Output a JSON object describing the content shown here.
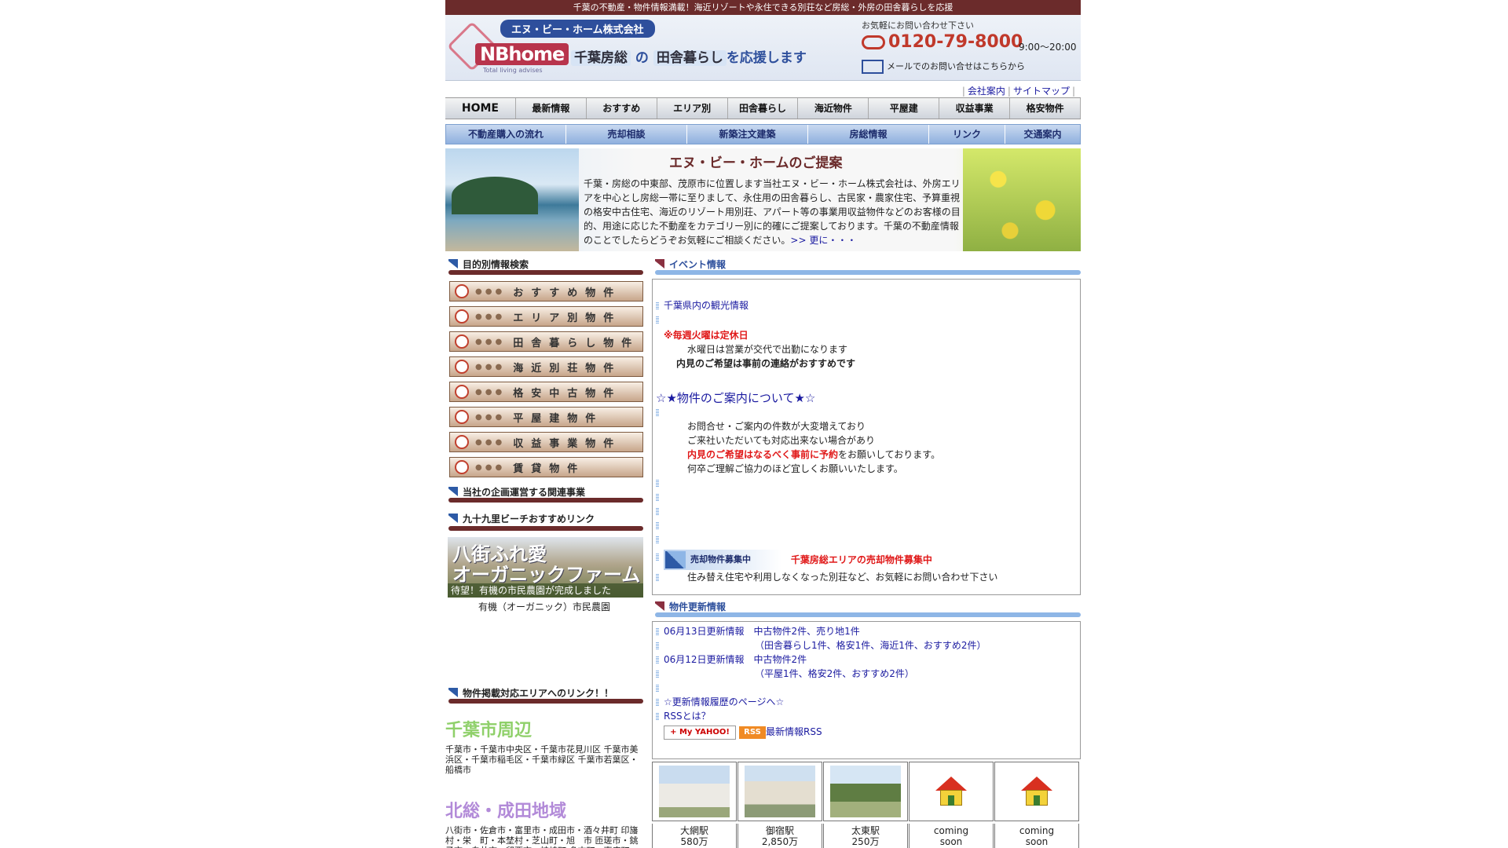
{
  "topbar": "千葉の不動産・物件情報満載！海近リゾートや永住できる別荘など房総・外房の田舎暮らしを応援",
  "header": {
    "company": "エヌ・ビー・ホーム株式会社",
    "logo": "NBhome",
    "logo_sub": "Total living advises",
    "tagline_a": "千葉房総",
    "tagline_b": "の",
    "tagline_c": "田舎暮らし",
    "tagline_d": "を応援します",
    "contact_note": "お気軽にお問い合わせ下さい",
    "phone": "0120-79-8000",
    "hours": "9:00〜20:00",
    "mail": "メールでのお問い合せはこちらから"
  },
  "subnav": {
    "company": "会社案内",
    "sitemap": "サイトマップ"
  },
  "mainnav": [
    "HOME",
    "最新情報",
    "おすすめ",
    "エリア別",
    "田舎暮らし",
    "海近物件",
    "平屋建",
    "収益事業",
    "格安物件"
  ],
  "subnav2": [
    "不動産購入の流れ",
    "売却相談",
    "新築注文建築",
    "房総情報",
    "リンク",
    "交通案内"
  ],
  "banner": {
    "title": "エヌ・ビー・ホームのご提案",
    "text": "千葉・房総の中東部、茂原市に位置します当社エヌ・ビー・ホーム株式会社は、外房エリアを中心とし房総一帯に至りまして、永住用の田舎暮らし、古民家・農家住宅、予算重視の格安中古住宅、海近のリゾート用別荘、アパート等の事業用収益物件などのお客様の目的、用途に応じた不動産をカテゴリー別に的確にご提案しております。千葉の不動産情報のことでしたらどうぞお気軽にご相談ください。",
    "more": ">> 更に・・・"
  },
  "left": {
    "search_head": "目的別情報検索",
    "categories": [
      "おすすめ物件",
      "エリア別物件",
      "田舎暮らし物件",
      "海近別荘物件",
      "格安中古物件",
      "平屋建物件",
      "収益事業物件",
      "賃貸物件"
    ],
    "related_head": "当社の企画運営する関連事業",
    "beach_head": "九十九里ビーチおすすめリンク",
    "farm_t1": "八街ふれ愛",
    "farm_t2": "オーガニックファーム",
    "farm_t3": "待望！有機の市民農園が完成しました",
    "farm_caption": "有機（オーガニック）市民農園",
    "area_head": "物件掲載対応エリアへのリンク！！",
    "area1_title": "千葉市周辺",
    "area1_list": "千葉市・千葉市中央区・千葉市花見川区 千葉市美浜区・千葉市稲毛区・千葉市緑区 千葉市若葉区・船橋市",
    "area2_title": "北総・成田地域",
    "area2_list": "八街市・佐倉市・富里市・成田市・酒々井町 印旛村・栄　町・本埜村・芝山町・旭　市 匝瑳市・銚子市・白井市・印西市・神崎町 多古町・東庄町"
  },
  "event": {
    "head": "イベント情報",
    "l1": "千葉県内の観光情報",
    "l2": "※毎週火曜は定休日",
    "l3": "水曜日は営業が交代で出勤になります",
    "l4": "内見のご希望は事前の連絡がおすすめです",
    "l5": "☆★物件のご案内について★☆",
    "l6": "お問合せ・ご案内の件数が大変増えており",
    "l7": "ご来社いただいても対応出来ない場合があり",
    "l8a": "内見のご希望はなるべく事前に予約",
    "l8b": "をお願いしております。",
    "l9": "何卒ご理解ご協力のほど宜しくお願いいたします。",
    "sale_badge": "売却物件募集中",
    "sale_title": "千葉房総エリアの売却物件募集中",
    "sale_text": "住み替え住宅や利用しなくなった別荘など、お気軽にお問い合わせ下さい"
  },
  "updates": {
    "head": "物件更新情報",
    "u1": "06月13日更新情報　中古物件2件、売り地1件",
    "u1b": "（田舎暮らし1件、格安1件、海近1件、おすすめ2件）",
    "u2": "06月12日更新情報　中古物件2件",
    "u2b": "（平屋1件、格安2件、おすすめ2件）",
    "history": "☆更新情報履歴のページへ☆",
    "rss_what": "RSSとは？",
    "myyahoo": "+ My YAHOO!",
    "rss": "RSS",
    "latest_rss": "最新情報RSS"
  },
  "properties": [
    {
      "station": "大網駅",
      "price": "580万"
    },
    {
      "station": "御宿駅",
      "price": "2,850万"
    },
    {
      "station": "太東駅",
      "price": "250万"
    },
    {
      "station": "coming",
      "price": "soon"
    },
    {
      "station": "coming",
      "price": "soon"
    }
  ],
  "colors": {
    "maroon": "#6b2b2b",
    "accent_blue": "#8eb6e6",
    "link": "#1a1aa0",
    "alert": "#e01818"
  }
}
